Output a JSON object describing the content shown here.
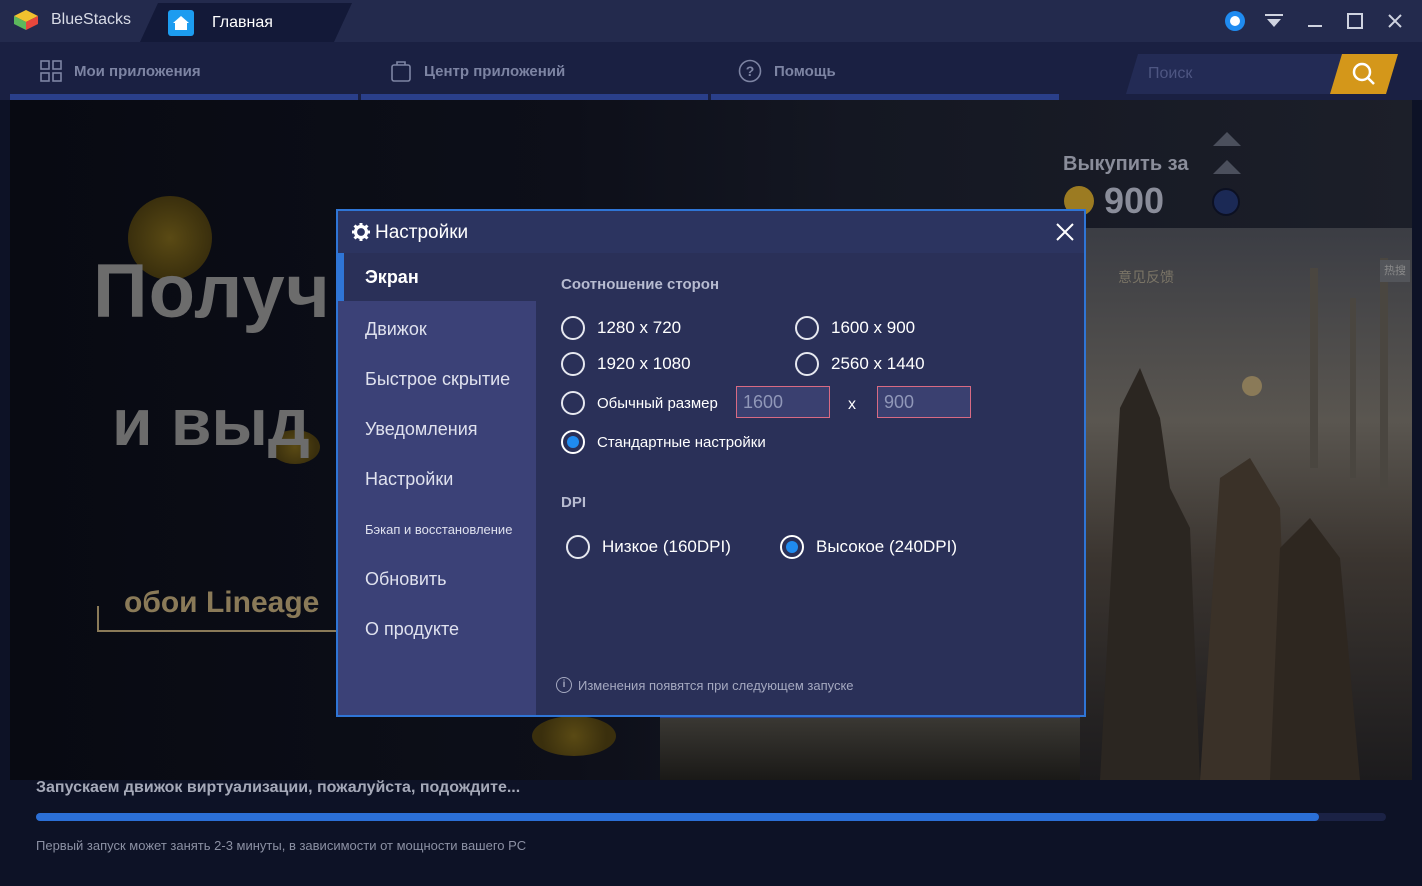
{
  "titlebar": {
    "app_name": "BlueStacks",
    "tab_label": "Главная"
  },
  "nav": {
    "items": [
      {
        "label": "Мои приложения",
        "icon": "grid-icon"
      },
      {
        "label": "Центр приложений",
        "icon": "bag-icon"
      },
      {
        "label": "Помощь",
        "icon": "help-icon"
      }
    ],
    "search_placeholder": "Поиск"
  },
  "background": {
    "promo_line1": "Получ",
    "promo_line2": "и выд",
    "promo_sub": "обои Lineage",
    "buy_label": "Выкупить за",
    "buy_price": "900",
    "feedback_text": "意见反馈",
    "tag_text": "热搜"
  },
  "status": {
    "message": "Запускаем движок виртуализации, пожалуйста, подождите...",
    "progress": 0.95,
    "note": "Первый запуск может занять 2-3 минуты, в зависимости от мощности вашего PC"
  },
  "dialog": {
    "title": "Настройки",
    "sidebar": [
      {
        "label": "Экран",
        "active": true
      },
      {
        "label": "Движок",
        "active": false
      },
      {
        "label": "Быстрое скрытие",
        "active": false
      },
      {
        "label": "Уведомления",
        "active": false
      },
      {
        "label": "Настройки",
        "active": false
      },
      {
        "label": "Бэкап и восстановление",
        "active": false
      },
      {
        "label": "Обновить",
        "active": false
      },
      {
        "label": "О продукте",
        "active": false
      }
    ],
    "aspect": {
      "title": "Соотношение сторон",
      "options": [
        {
          "label": "1280 x 720",
          "checked": false
        },
        {
          "label": "1600 x 900",
          "checked": false
        },
        {
          "label": "1920 x 1080",
          "checked": false
        },
        {
          "label": "2560 x 1440",
          "checked": false
        },
        {
          "label": "Обычный размер",
          "checked": false
        },
        {
          "label": "Стандартные настройки",
          "checked": true
        }
      ],
      "custom_width": "1600",
      "custom_height": "900",
      "x_sep": "x"
    },
    "dpi": {
      "title": "DPI",
      "options": [
        {
          "label": "Низкое (160DPI)",
          "checked": false
        },
        {
          "label": "Высокое (240DPI)",
          "checked": true
        }
      ]
    },
    "note": "Изменения появятся при следующем запуске"
  },
  "colors": {
    "accent": "#2f75d6",
    "radio_checked": "#1f8bf0",
    "search_button": "#d4971a"
  }
}
